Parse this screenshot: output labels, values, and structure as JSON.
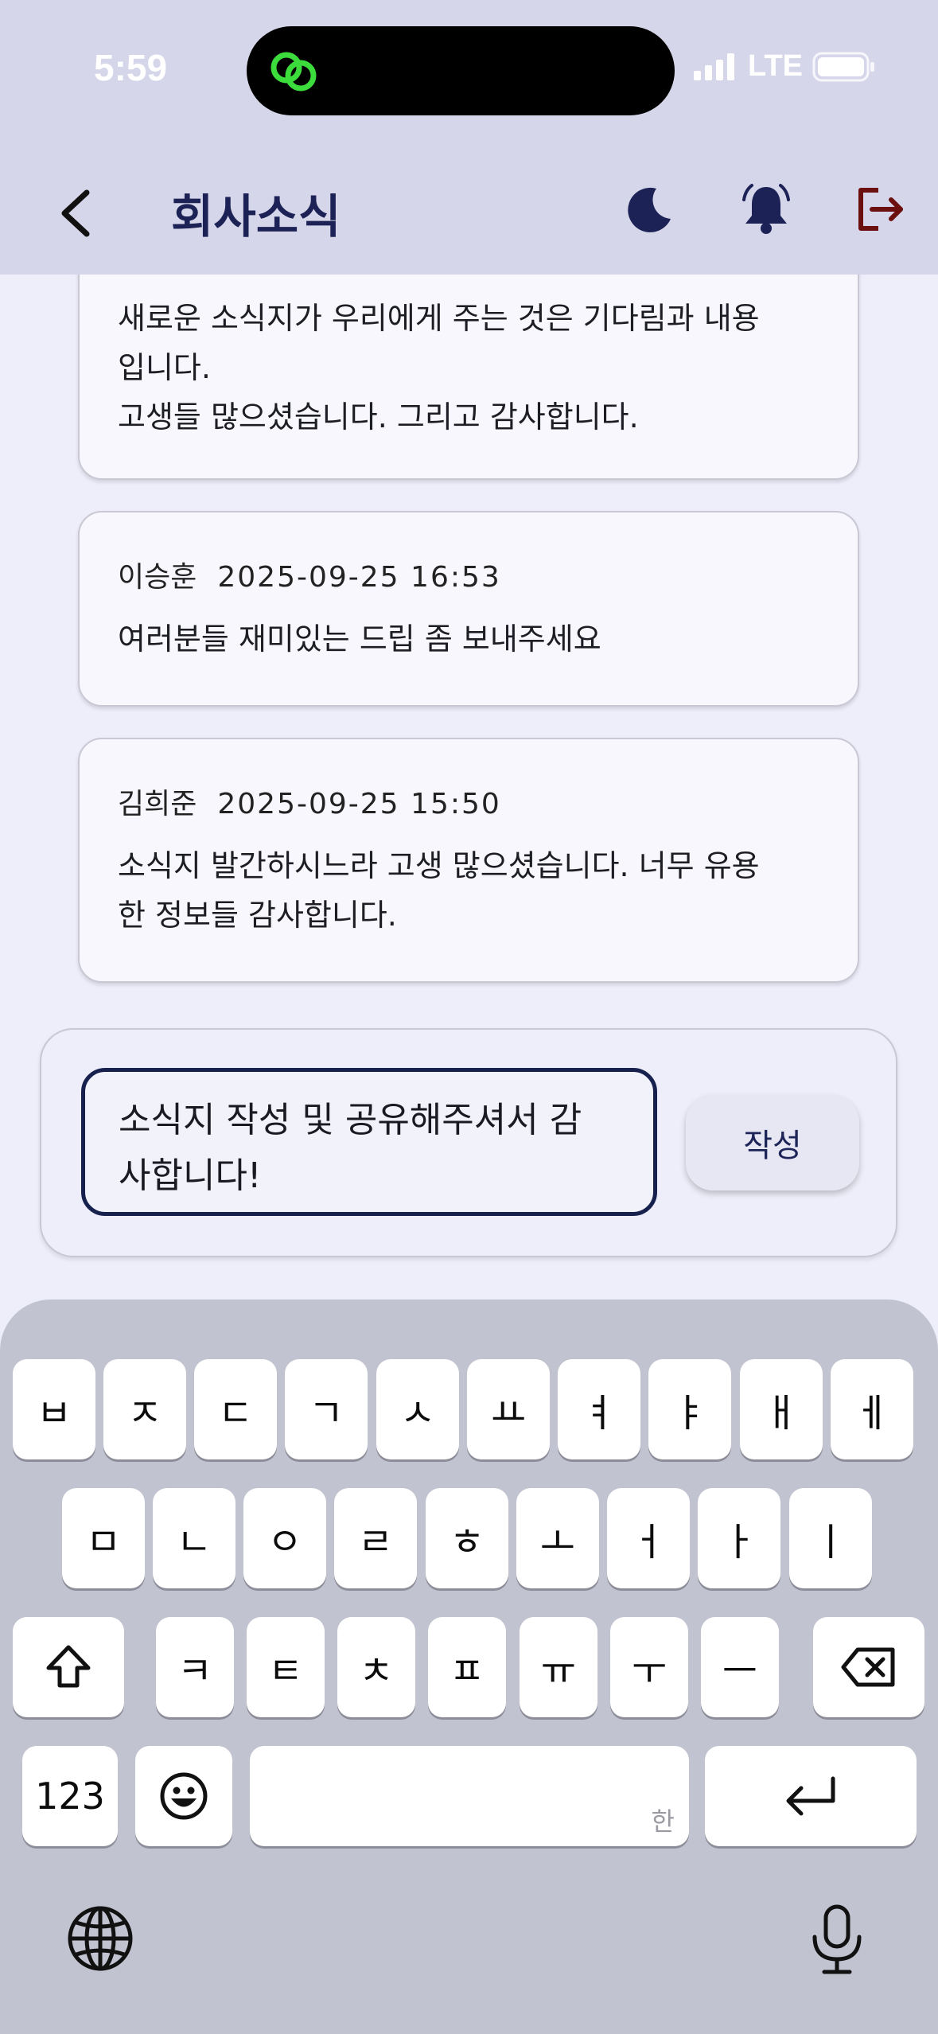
{
  "status_bar": {
    "time": "5:59",
    "network": "LTE"
  },
  "header": {
    "title": "회사소식"
  },
  "comments": [
    {
      "body_lines": [
        "새로운 소식지가 우리에게 주는 것은 기다림과 내용",
        "입니다.",
        "고생들 많으셨습니다. 그리고 감사합니다."
      ]
    },
    {
      "author": "이승훈",
      "date": "2025-09-25 16:53",
      "body_lines": [
        "여러분들 재미있는 드립 좀 보내주세요"
      ]
    },
    {
      "author": "김희준",
      "date": "2025-09-25 15:50",
      "body_lines": [
        "소식지 발간하시느라 고생 많으셨습니다. 너무 유용",
        "한 정보들 감사합니다."
      ]
    }
  ],
  "compose": {
    "input_lines": [
      "소식지 작성 및 공유해주셔서 감",
      "사합니다!"
    ],
    "submit_label": "작성"
  },
  "keyboard": {
    "row1": [
      "ㅂ",
      "ㅈ",
      "ㄷ",
      "ㄱ",
      "ㅅ",
      "ㅛ",
      "ㅕ",
      "ㅑ",
      "ㅐ",
      "ㅔ"
    ],
    "row2": [
      "ㅁ",
      "ㄴ",
      "ㅇ",
      "ㄹ",
      "ㅎ",
      "ㅗ",
      "ㅓ",
      "ㅏ",
      "ㅣ"
    ],
    "row3": [
      "ㅋ",
      "ㅌ",
      "ㅊ",
      "ㅍ",
      "ㅠ",
      "ㅜ",
      "ㅡ"
    ],
    "numbers_label": "123",
    "space_hint": "한"
  },
  "colors": {
    "accent": "#1c2255",
    "logout": "#6b0f0f",
    "status_icon": "#3ddc3d"
  },
  "icons": [
    "back-icon",
    "moon-icon",
    "bell-icon",
    "logout-icon",
    "shift-icon",
    "backspace-icon",
    "emoji-icon",
    "return-icon",
    "globe-icon",
    "microphone-icon"
  ]
}
